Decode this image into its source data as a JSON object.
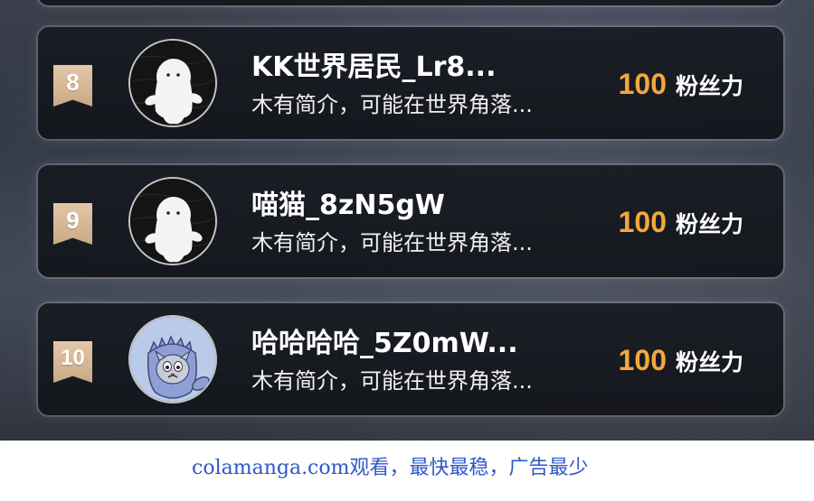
{
  "leaderboard": {
    "entries": [
      {
        "rank": "8",
        "name": "KK世界居民_Lr8...",
        "bio": "木有简介，可能在世界角落...",
        "fans_value": "100",
        "fans_label": "粉丝力",
        "avatar": "ghost-avatar-icon"
      },
      {
        "rank": "9",
        "name": "喵猫_8zN5gW",
        "bio": "木有简介，可能在世界角落...",
        "fans_value": "100",
        "fans_label": "粉丝力",
        "avatar": "ghost-avatar-icon"
      },
      {
        "rank": "10",
        "name": "哈哈哈哈_5Z0mW...",
        "bio": "木有简介，可能在世界角落...",
        "fans_value": "100",
        "fans_label": "粉丝力",
        "avatar": "dino-cat-avatar-icon"
      }
    ]
  },
  "footer": {
    "watermark": "colamanga.com观看，最快最稳，广告最少"
  },
  "colors": {
    "badge": "#d8b998",
    "fans_value": "#f2a93b",
    "watermark": "#2f58c8"
  }
}
